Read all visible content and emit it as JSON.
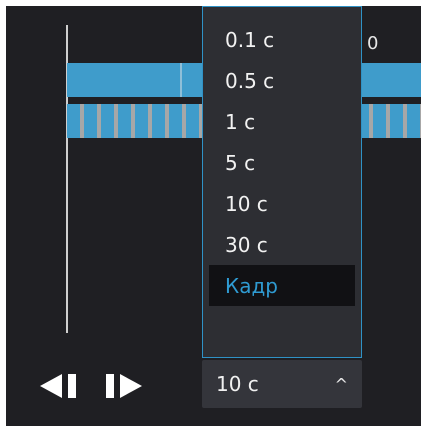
{
  "timeline": {
    "ruler_label": "0"
  },
  "controls": {
    "prev_label": "Previous frame",
    "next_label": "Next frame"
  },
  "step_select": {
    "value": "10 c",
    "options": [
      "0.1 c",
      "0.5 c",
      "1 c",
      "5 c",
      "10 c",
      "30 c",
      "Кадр"
    ],
    "highlighted_option": "Кадр"
  },
  "colors": {
    "panel_bg": "#1f1f23",
    "track_blue": "#3f9ccb",
    "accent": "#2f9bd2",
    "dropdown_bg": "#2d2e33",
    "select_bg": "#34353b"
  },
  "icons": [
    "step-back-icon",
    "step-forward-icon",
    "chevron-up-icon"
  ]
}
